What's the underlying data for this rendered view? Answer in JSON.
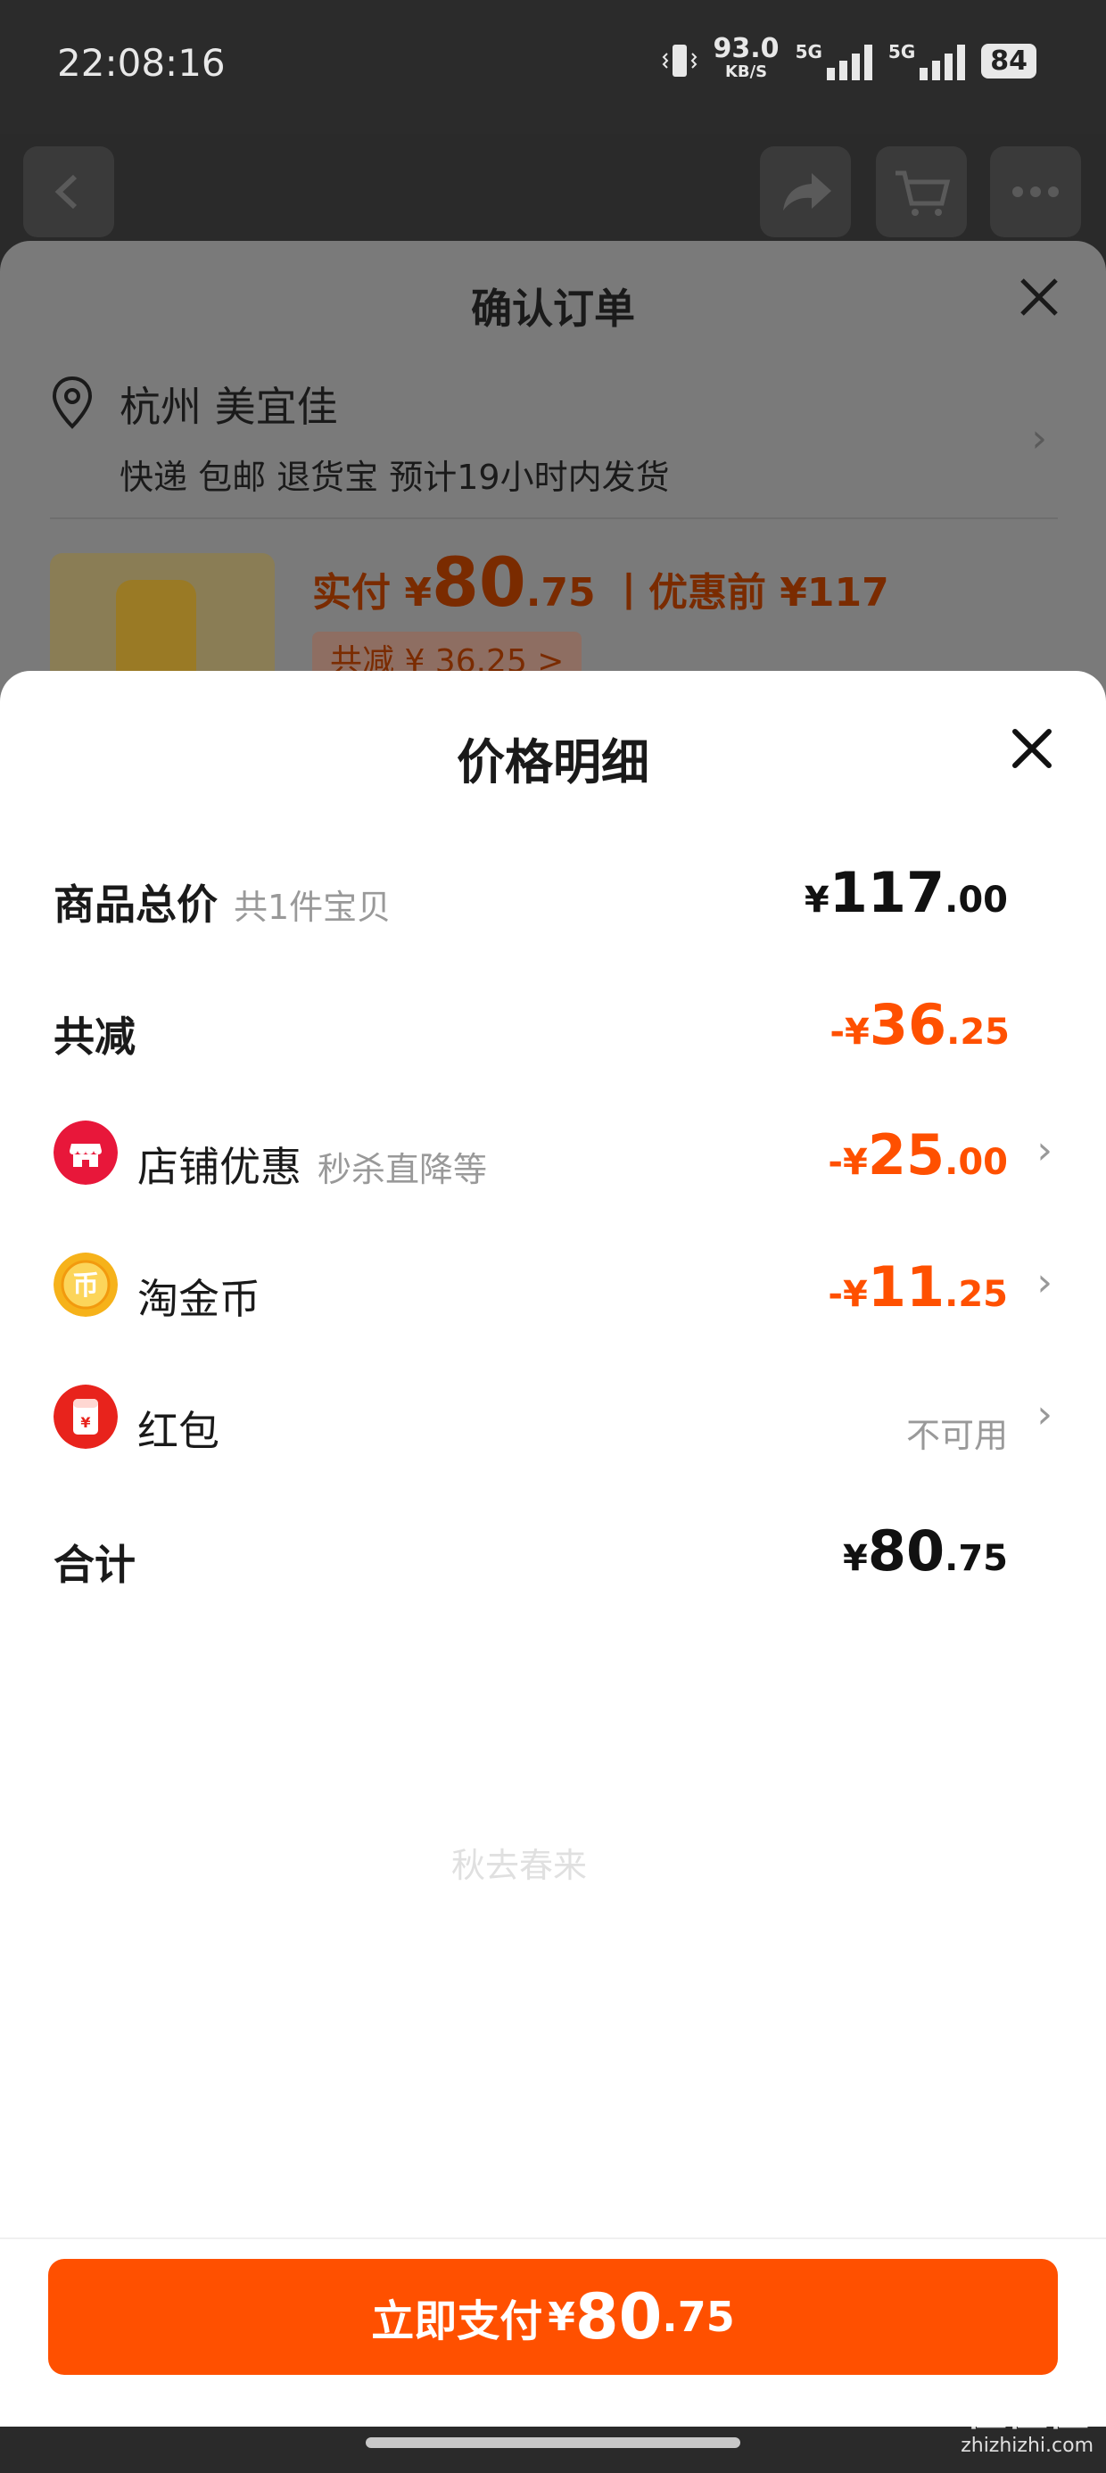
{
  "status_bar": {
    "time": "22:08:16",
    "net_speed": "93.0",
    "net_unit": "KB/S",
    "signal1": "5G",
    "signal2": "5G",
    "battery": "84"
  },
  "order": {
    "title": "确认订单",
    "address_name": "杭州 美宜佳",
    "address_sub": "快递 包邮 退货宝 预计19小时内发货",
    "pay_label": "实付 ¥",
    "pay_int": "80",
    "pay_dec": ".75",
    "before_label": "丨优惠前 ¥117",
    "saved": "共减 ¥ 36.25 >"
  },
  "detail": {
    "title": "价格明细",
    "rows": {
      "total": {
        "label": "商品总价",
        "sub": "共1件宝贝",
        "cur": "¥",
        "int": "117",
        "dec": ".00"
      },
      "reduce": {
        "label": "共减",
        "cur": "-¥",
        "int": "36",
        "dec": ".25"
      },
      "shop": {
        "label": "店铺优惠",
        "sub": "秒杀直降等",
        "cur": "-¥",
        "int": "25",
        "dec": ".00"
      },
      "coin": {
        "label": "淘金币",
        "cur": "-¥",
        "int": "11",
        "dec": ".25"
      },
      "redpack": {
        "label": "红包",
        "status": "不可用"
      },
      "sum": {
        "label": "合计",
        "cur": "¥",
        "int": "80",
        "dec": ".75"
      }
    },
    "watermark": "秋去春来"
  },
  "pay_button": {
    "label": "立即支付",
    "cur": "¥",
    "int": "80",
    "dec": ".75"
  },
  "brand_watermark": {
    "text": "值值值",
    "url": "zhizhizhi.com"
  },
  "colors": {
    "accent": "#ff5000",
    "shop_icon": "#e8173a",
    "coin_icon": "#f6b21a",
    "redpack_icon": "#e8231c"
  }
}
